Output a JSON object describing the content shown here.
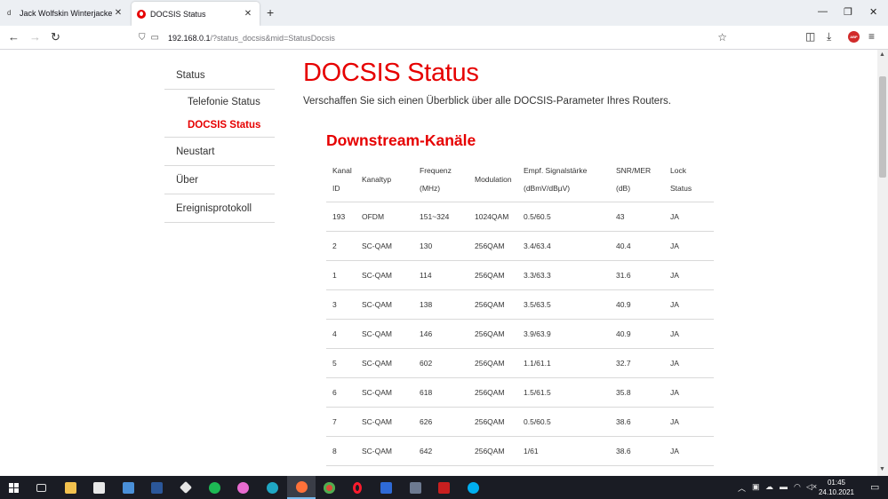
{
  "browser": {
    "tabs": [
      {
        "title": "Jack Wolfskin Winterjacke »OST",
        "favicon": "d",
        "active": false
      },
      {
        "title": "DOCSIS Status",
        "favicon": "vodafone-icon",
        "active": true
      }
    ],
    "url_host": "192.168.0.1",
    "url_path": "/?status_docsis&mid=StatusDocsis"
  },
  "sidebar": {
    "status": "Status",
    "telefonie": "Telefonie Status",
    "docsis": "DOCSIS Status",
    "neustart": "Neustart",
    "ueber": "Über",
    "ereignis": "Ereignisprotokoll"
  },
  "main": {
    "title": "DOCSIS Status",
    "subtitle": "Verschaffen Sie sich einen Überblick über alle DOCSIS-Parameter Ihres Routers.",
    "downstream_title": "Downstream-Kanäle"
  },
  "table": {
    "headers": [
      [
        "Kanal",
        "ID"
      ],
      [
        "Kanaltyp"
      ],
      [
        "Frequenz",
        "(MHz)"
      ],
      [
        "Modulation"
      ],
      [
        "Empf. Signalstärke",
        "(dBmV/dBµV)"
      ],
      [
        "SNR/MER",
        "(dB)"
      ],
      [
        "Lock",
        "Status"
      ]
    ],
    "rows": [
      [
        "193",
        "OFDM",
        "151~324",
        "1024QAM",
        "0.5/60.5",
        "43",
        "JA"
      ],
      [
        "2",
        "SC-QAM",
        "130",
        "256QAM",
        "3.4/63.4",
        "40.4",
        "JA"
      ],
      [
        "1",
        "SC-QAM",
        "114",
        "256QAM",
        "3.3/63.3",
        "31.6",
        "JA"
      ],
      [
        "3",
        "SC-QAM",
        "138",
        "256QAM",
        "3.5/63.5",
        "40.9",
        "JA"
      ],
      [
        "4",
        "SC-QAM",
        "146",
        "256QAM",
        "3.9/63.9",
        "40.9",
        "JA"
      ],
      [
        "5",
        "SC-QAM",
        "602",
        "256QAM",
        "1.1/61.1",
        "32.7",
        "JA"
      ],
      [
        "6",
        "SC-QAM",
        "618",
        "256QAM",
        "1.5/61.5",
        "35.8",
        "JA"
      ],
      [
        "7",
        "SC-QAM",
        "626",
        "256QAM",
        "0.5/60.5",
        "38.6",
        "JA"
      ],
      [
        "8",
        "SC-QAM",
        "642",
        "256QAM",
        "1/61",
        "38.6",
        "JA"
      ]
    ]
  },
  "taskbar": {
    "time": "01:45",
    "date": "24.10.2021",
    "apps": [
      "task-view-icon",
      "file-explorer-icon",
      "store-icon",
      "mail-icon",
      "word-icon",
      "dropbox-icon",
      "spotify-icon",
      "itunes-icon",
      "edge-icon",
      "firefox-icon",
      "chrome-icon",
      "opera-icon",
      "sky-icon",
      "calculator-icon",
      "acrobat-icon",
      "skype-icon"
    ]
  },
  "colors": {
    "accent": "#e60000",
    "text": "#333333",
    "divider": "#d9d9d9",
    "taskbar": "#1a1c24"
  }
}
